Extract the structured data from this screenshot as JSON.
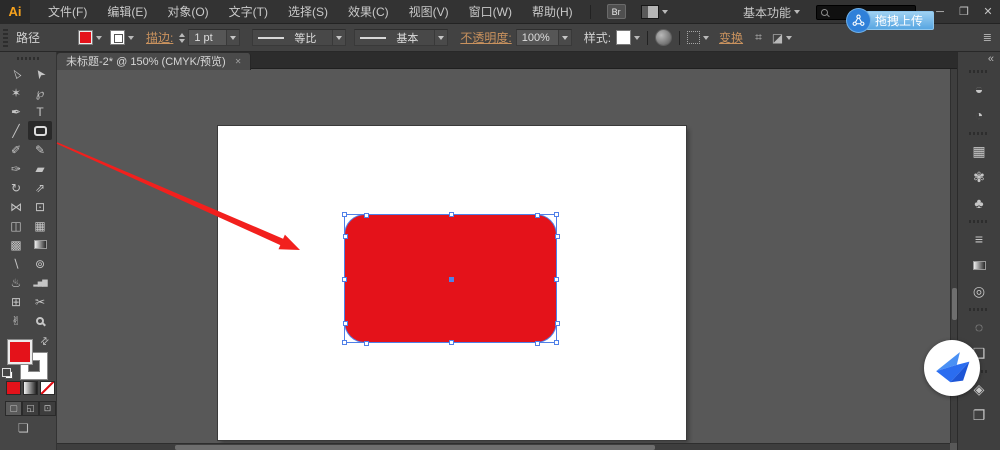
{
  "titlebar": {
    "logo": "Ai",
    "menus": [
      "文件(F)",
      "编辑(E)",
      "对象(O)",
      "文字(T)",
      "选择(S)",
      "效果(C)",
      "视图(V)",
      "窗口(W)",
      "帮助(H)"
    ],
    "bridge_label": "Br",
    "workspace_label": "基本功能",
    "controls": {
      "minimize": "─",
      "maximize": "❐",
      "close": "✕"
    }
  },
  "upload_button": {
    "label": "拖拽上传"
  },
  "control_bar": {
    "context_label": "路径",
    "stroke_label": "描边:",
    "stroke_weight": "1 pt",
    "width_profile": "等比",
    "brush_definition": "基本",
    "opacity_label": "不透明度:",
    "opacity_value": "100%",
    "style_label": "样式:",
    "transform_label": "变换",
    "icons": {
      "align_artboard": "⌗",
      "arrange": "◪",
      "collapse": "≣"
    }
  },
  "document_tab": {
    "title": "未标题-2* @ 150% (CMYK/预览)",
    "close_glyph": "✕"
  },
  "tools": [
    {
      "name": "selection-tool",
      "glyph": "▻"
    },
    {
      "name": "direct-selection-tool",
      "glyph": "➤"
    },
    {
      "name": "magic-wand-tool",
      "glyph": "✶"
    },
    {
      "name": "lasso-tool",
      "glyph": "℘"
    },
    {
      "name": "pen-tool",
      "glyph": "✒"
    },
    {
      "name": "type-tool",
      "glyph": "T"
    },
    {
      "name": "line-segment-tool",
      "glyph": "╱"
    },
    {
      "name": "rounded-rectangle-tool",
      "glyph": "",
      "selected": true
    },
    {
      "name": "paintbrush-tool",
      "glyph": "✐"
    },
    {
      "name": "pencil-tool",
      "glyph": "✎"
    },
    {
      "name": "blob-brush-tool",
      "glyph": "✑"
    },
    {
      "name": "eraser-tool",
      "glyph": "▰"
    },
    {
      "name": "rotate-tool",
      "glyph": "↻"
    },
    {
      "name": "scale-tool",
      "glyph": "⇗"
    },
    {
      "name": "width-tool",
      "glyph": "⋈"
    },
    {
      "name": "free-transform-tool",
      "glyph": "⊡"
    },
    {
      "name": "shape-builder-tool",
      "glyph": "◫"
    },
    {
      "name": "perspective-grid-tool",
      "glyph": "▦"
    },
    {
      "name": "mesh-tool",
      "glyph": "▩"
    },
    {
      "name": "gradient-tool",
      "glyph": ""
    },
    {
      "name": "eyedropper-tool",
      "glyph": "∖"
    },
    {
      "name": "blend-tool",
      "glyph": "⊚"
    },
    {
      "name": "symbol-sprayer-tool",
      "glyph": "♨"
    },
    {
      "name": "column-graph-tool",
      "glyph": "▂▅▇"
    },
    {
      "name": "artboard-tool",
      "glyph": "⊞"
    },
    {
      "name": "slice-tool",
      "glyph": "✂"
    },
    {
      "name": "hand-tool",
      "glyph": "✌"
    },
    {
      "name": "zoom-tool",
      "glyph": ""
    }
  ],
  "toolbar_footer": {
    "swap_glyph": "⇄",
    "draw_modes": [
      "▢",
      "◱",
      "⊡"
    ],
    "screen_mode_glyph": "❏"
  },
  "dock": {
    "collapse_glyph": "«",
    "panels": [
      {
        "name": "color",
        "glyph": "◒"
      },
      {
        "name": "color-guide",
        "glyph": "◔"
      },
      {
        "name": "swatches",
        "glyph": "▦"
      },
      {
        "name": "brushes",
        "glyph": "✾"
      },
      {
        "name": "symbols",
        "glyph": "♣"
      },
      {
        "name": "stroke",
        "glyph": "≡"
      },
      {
        "name": "gradient",
        "glyph": ""
      },
      {
        "name": "transparency",
        "glyph": "◎"
      },
      {
        "name": "appearance",
        "glyph": "◌"
      },
      {
        "name": "graphic-styles",
        "glyph": "❑"
      },
      {
        "name": "layers",
        "glyph": "◈"
      },
      {
        "name": "artboards",
        "glyph": "❐"
      }
    ]
  },
  "colors": {
    "shape_fill": "#e4121a",
    "selection_blue": "#4f80e8",
    "link_orange": "#c9925e",
    "annotation_arrow": "#f2201d",
    "upload_blue": "#6fb3e8"
  }
}
